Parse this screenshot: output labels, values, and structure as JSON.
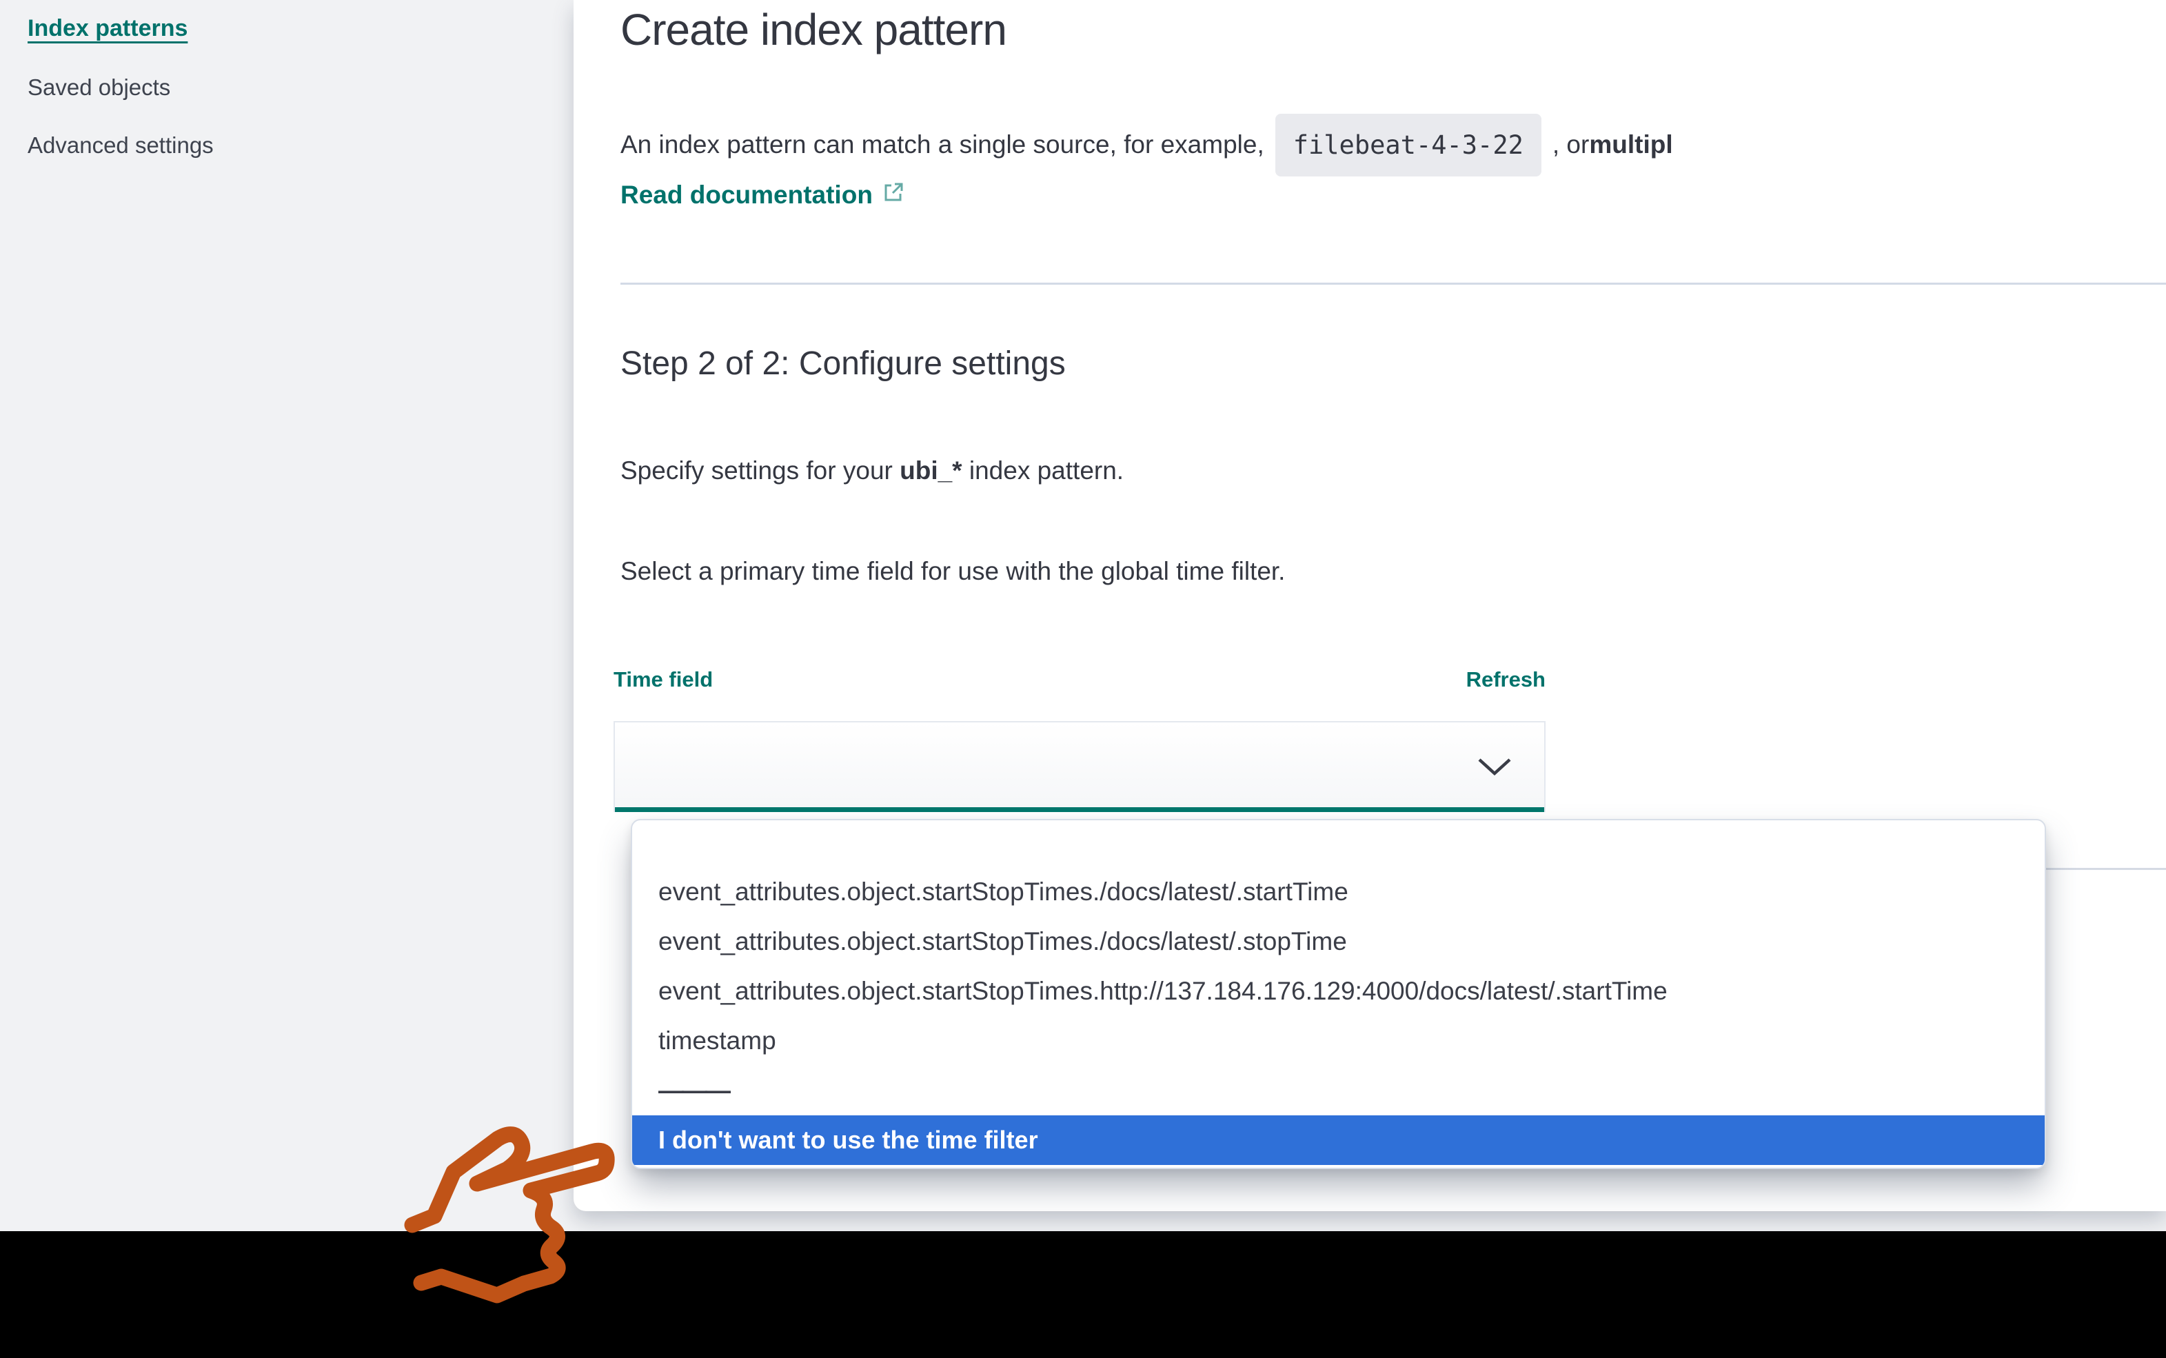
{
  "sidebar": {
    "items": [
      {
        "label": "Index patterns",
        "active": true
      },
      {
        "label": "Saved objects",
        "active": false
      },
      {
        "label": "Advanced settings",
        "active": false
      }
    ]
  },
  "main": {
    "title": "Create index pattern",
    "intro": {
      "before": "An index pattern can match a single source, for example,",
      "code": "filebeat-4-3-22",
      "after": ", or ",
      "after_bold": "multipl"
    },
    "doc_link": "Read documentation",
    "step_heading": "Step 2 of 2: Configure settings",
    "specify": {
      "before": "Specify settings for your ",
      "pattern": "ubi_*",
      "after": " index pattern."
    },
    "select_hint": "Select a primary time field for use with the global time filter.",
    "time_field_label": "Time field",
    "refresh_label": "Refresh",
    "combobox": {
      "value": ""
    },
    "dropdown": {
      "options": [
        "event_attributes.object.startStopTimes./docs/latest/.startTime",
        "event_attributes.object.startStopTimes./docs/latest/.stopTime",
        "event_attributes.object.startStopTimes.http://137.184.176.129:4000/docs/latest/.startTime",
        "timestamp"
      ],
      "divider": "———",
      "selected_option": "I don't want to use the time filter"
    }
  },
  "colors": {
    "accent_teal": "#00726B",
    "underline_teal": "#01776C",
    "selected_blue": "#2F70D8",
    "text": "#343741",
    "divider_gray": "#D3DAE6",
    "hand_orange": "#C05317",
    "page_bg": "#F1F2F4"
  }
}
